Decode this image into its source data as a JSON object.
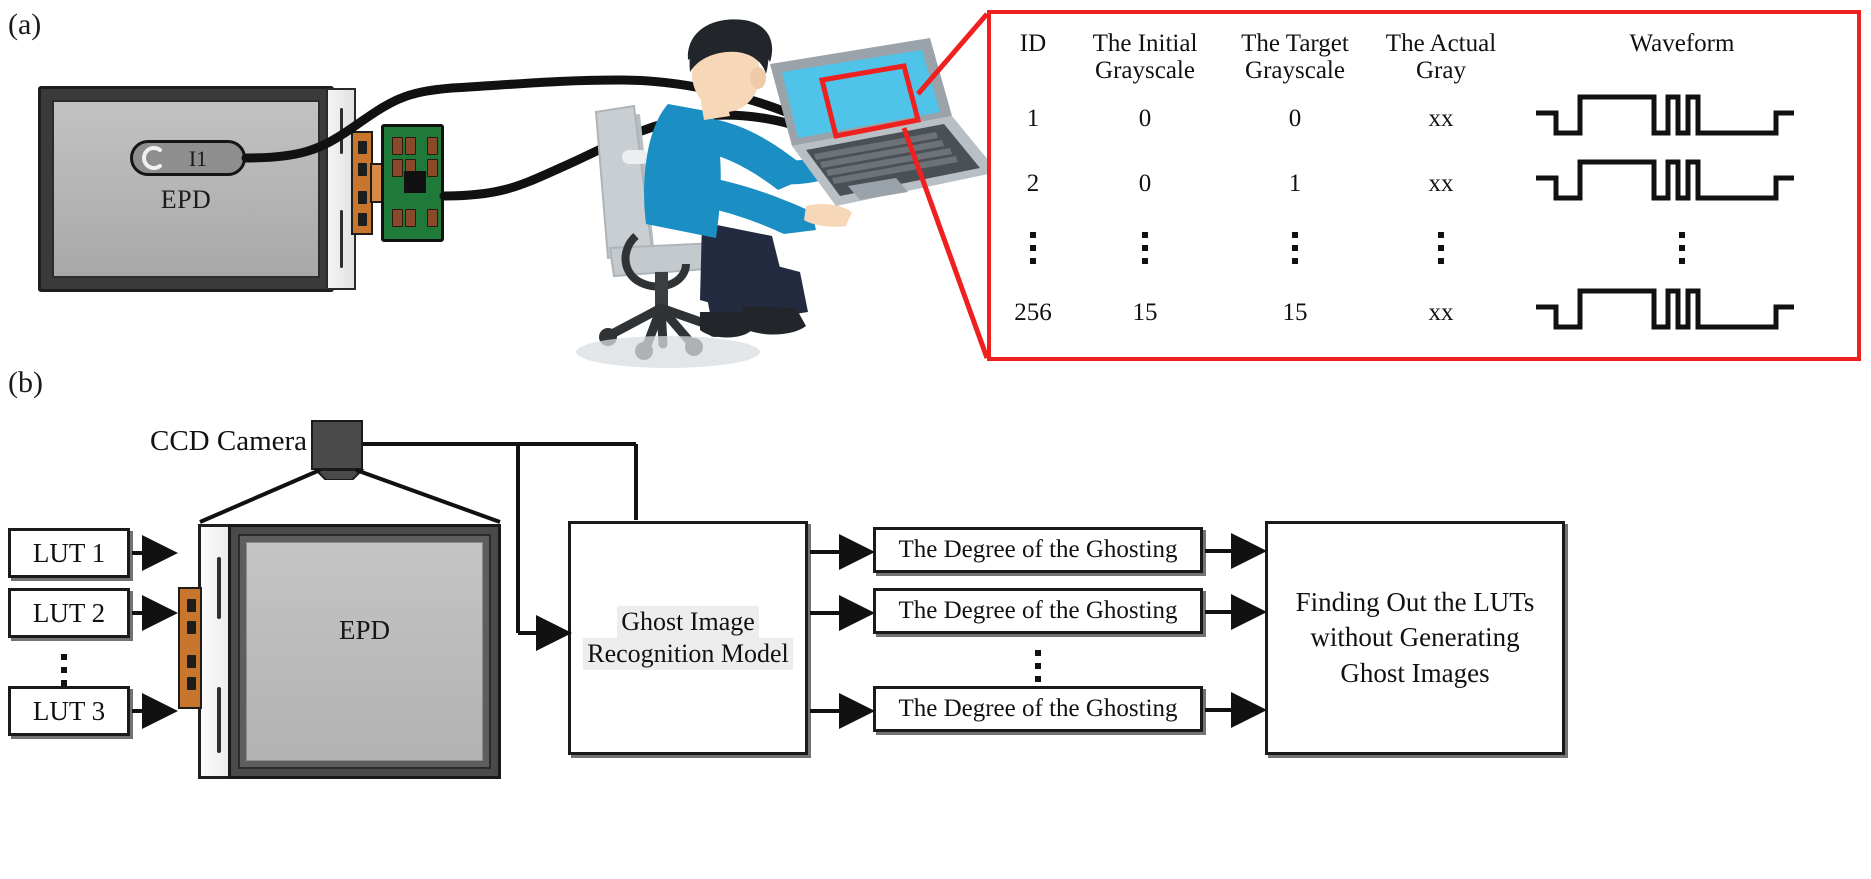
{
  "panels": {
    "a_label": "(a)",
    "b_label": "(b)"
  },
  "panel_a": {
    "epd_label": "EPD",
    "indicator_label": "I1",
    "callout": {
      "table": {
        "headers": [
          "ID",
          "The Initial Grayscale",
          "The Target Grayscale",
          "The Actual Gray",
          "Waveform"
        ],
        "header_lines": [
          [
            "ID",
            ""
          ],
          [
            "The Initial",
            "Grayscale"
          ],
          [
            "The Target",
            "Grayscale"
          ],
          [
            "The Actual",
            "Gray"
          ],
          [
            "Waveform",
            ""
          ]
        ],
        "rows": [
          {
            "id": "1",
            "initial_grayscale": "0",
            "target_grayscale": "0",
            "actual_gray": "xx",
            "waveform": "pulse-train"
          },
          {
            "id": "2",
            "initial_grayscale": "0",
            "target_grayscale": "1",
            "actual_gray": "xx",
            "waveform": "pulse-train"
          },
          {
            "id": "⋮",
            "initial_grayscale": "⋮",
            "target_grayscale": "⋮",
            "actual_gray": "⋮",
            "waveform": "⋮"
          },
          {
            "id": "256",
            "initial_grayscale": "15",
            "target_grayscale": "15",
            "actual_gray": "xx",
            "waveform": "pulse-train"
          }
        ]
      },
      "border_color": "#ef2020"
    }
  },
  "panel_b": {
    "ccd_camera_label": "CCD Camera",
    "epd_label": "EPD",
    "lut_boxes": [
      {
        "label": "LUT 1"
      },
      {
        "label": "LUT 2"
      },
      {
        "label": "LUT 3"
      }
    ],
    "lut_ellipsis": "⋮",
    "ghost_model": {
      "line1": "Ghost Image",
      "line2": "Recognition Model"
    },
    "degree_boxes": [
      {
        "label": "The Degree of the Ghosting"
      },
      {
        "label": "The Degree of the Ghosting"
      },
      {
        "label": "The Degree of the Ghosting"
      }
    ],
    "degree_ellipsis": "⋮",
    "final_box": {
      "line1": "Finding Out the LUTs",
      "line2": "without Generating",
      "line3": "Ghost Images"
    }
  },
  "colors": {
    "callout_red": "#ef2020",
    "pcb_green": "#1f7a3a",
    "connector_orange": "#c8752e",
    "shirt_blue": "#1b8fc4",
    "pants_navy": "#222b40",
    "screen_blue": "#4fc3e8",
    "chair_gray": "#b9bec2",
    "epd_gray": "#b8b8b8"
  }
}
